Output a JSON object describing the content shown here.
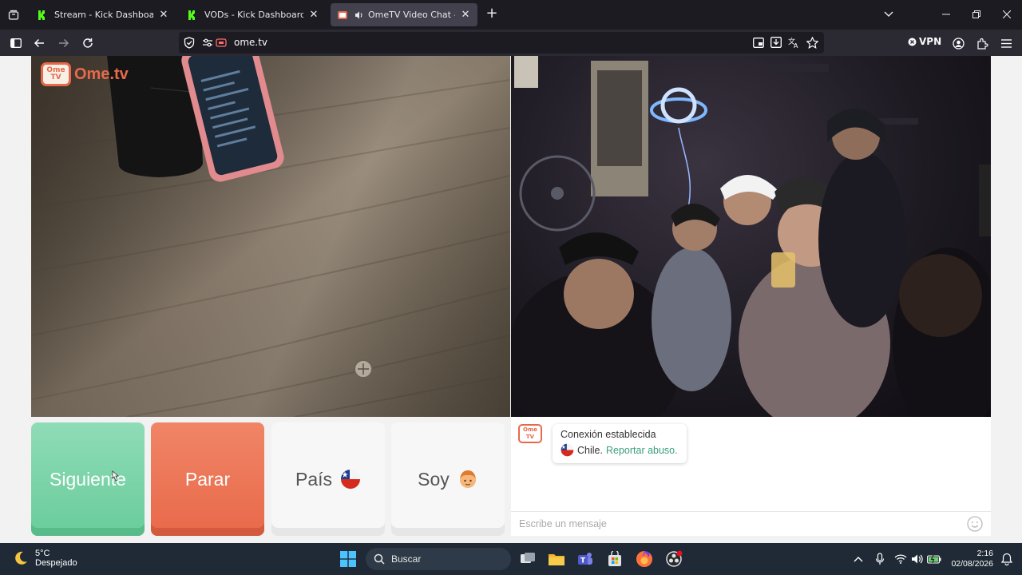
{
  "browser": {
    "tabs": [
      {
        "title": "Stream - Kick Dashboard",
        "active": false,
        "favicon": "kick-icon"
      },
      {
        "title": "VODs - Kick Dashboard",
        "active": false,
        "favicon": "kick-icon"
      },
      {
        "title": "OmeTV Video Chat — Ome",
        "active": true,
        "favicon": "ometv-icon",
        "audio": true
      }
    ],
    "url": "ome.tv",
    "vpn_label": "VPN"
  },
  "page": {
    "logo_tv": "Ome TV",
    "logo_text": "Ome.tv",
    "buttons": {
      "next": "Siguiente",
      "stop": "Parar",
      "country": "País",
      "country_flag": "chile-flag-icon",
      "soy": "Soy",
      "soy_icon": "boy-avatar-icon"
    },
    "chat": {
      "status": "Conexión establecida",
      "country": "Chile.",
      "report": "Reportar abuso.",
      "input_placeholder": "Escribe un mensaje"
    },
    "colors": {
      "next": "#69cc9b",
      "stop": "#e8694a",
      "brand": "#e8694a",
      "link": "#3aa07a"
    }
  },
  "taskbar": {
    "weather_temp": "5°C",
    "weather_desc": "Despejado",
    "search_label": "Buscar",
    "time": "2:16",
    "date": "02/08/2026"
  }
}
